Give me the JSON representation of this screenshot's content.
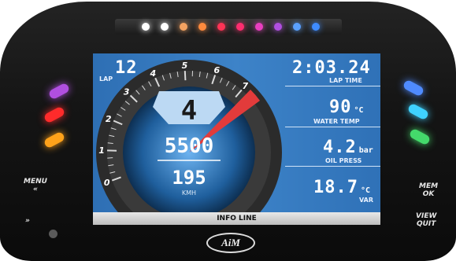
{
  "dashboard": {
    "shift_lights": [
      "#ffffff",
      "#ffffff",
      "#f4a261",
      "#ff8a3d",
      "#ff3355",
      "#ff2d6f",
      "#e83fbf",
      "#b04fe0",
      "#5aa0ff",
      "#3e8bff"
    ],
    "left_leds": [
      "#b04fe0",
      "#ff2b2b",
      "#ffa21a"
    ],
    "right_leds": [
      "#4f8bff",
      "#3fd2ff",
      "#44d96b"
    ],
    "gear": "4",
    "rpm": "5500",
    "speed": "195",
    "speed_unit": "KMH",
    "rpm_scale": [
      "0",
      "1",
      "2",
      "3",
      "4",
      "5",
      "6",
      "7"
    ],
    "lap": {
      "value": "12",
      "label": "LAP"
    },
    "lap_time": {
      "value": "2:03.24",
      "label": "LAP TIME"
    },
    "water_temp": {
      "value": "90",
      "unit": "°C",
      "label": "WATER TEMP"
    },
    "oil_press": {
      "value": "4.2",
      "unit": "bar",
      "label": "OIL PRESS"
    },
    "var": {
      "value": "18.7",
      "unit": "°C",
      "label": "VAR"
    },
    "info_line": "INFO LINE",
    "buttons": {
      "menu": "MENU",
      "menu_symbol": "«",
      "next_symbol": "»",
      "mem": "MEM",
      "ok": "OK",
      "view": "VIEW",
      "quit": "QUIT"
    },
    "logo": "AiM"
  }
}
